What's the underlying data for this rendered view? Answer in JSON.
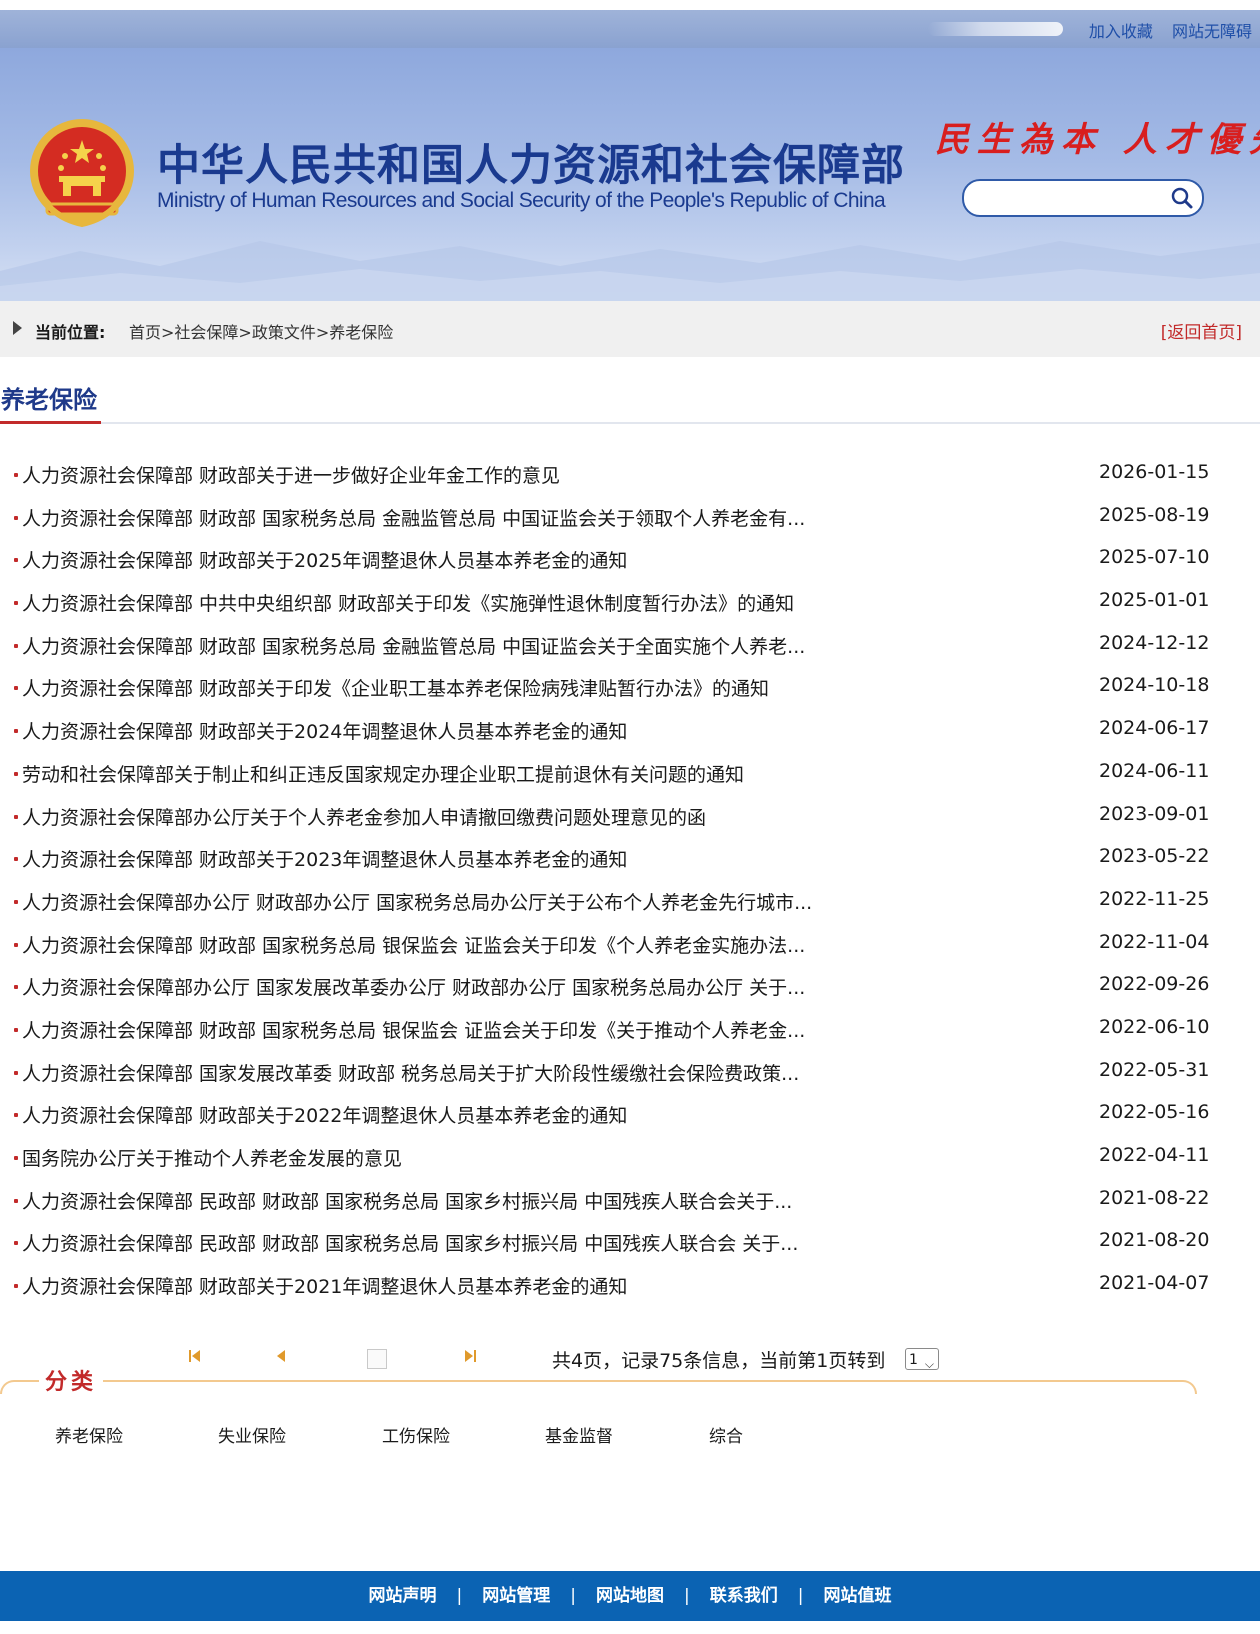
{
  "topbar": {
    "links": [
      "加入收藏",
      "网站无障碍"
    ]
  },
  "header": {
    "title_cn": "中华人民共和国人力资源和社会保障部",
    "title_en": "Ministry of Human Resources and Social Security of the People's Republic of China",
    "slogan": "民生為本 人才優先",
    "search": {
      "placeholder": ""
    }
  },
  "breadcrumb": {
    "label": "当前位置:",
    "path": "首页>社会保障>政策文件>养老保险",
    "back_home": "[返回首页]"
  },
  "section": {
    "title": "养老保险"
  },
  "items": [
    {
      "title": "人力资源社会保障部 财政部关于进一步做好企业年金工作的意见",
      "date": "2026-01-15"
    },
    {
      "title": "人力资源社会保障部 财政部 国家税务总局 金融监管总局 中国证监会关于领取个人养老金有...",
      "date": "2025-08-19"
    },
    {
      "title": "人力资源社会保障部 财政部关于2025年调整退休人员基本养老金的通知",
      "date": "2025-07-10"
    },
    {
      "title": "人力资源社会保障部 中共中央组织部 财政部关于印发《实施弹性退休制度暂行办法》的通知",
      "date": "2025-01-01"
    },
    {
      "title": "人力资源社会保障部 财政部 国家税务总局 金融监管总局 中国证监会关于全面实施个人养老...",
      "date": "2024-12-12"
    },
    {
      "title": "人力资源社会保障部 财政部关于印发《企业职工基本养老保险病残津贴暂行办法》的通知",
      "date": "2024-10-18"
    },
    {
      "title": "人力资源社会保障部 财政部关于2024年调整退休人员基本养老金的通知",
      "date": "2024-06-17"
    },
    {
      "title": "劳动和社会保障部关于制止和纠正违反国家规定办理企业职工提前退休有关问题的通知",
      "date": "2024-06-11"
    },
    {
      "title": "人力资源社会保障部办公厅关于个人养老金参加人申请撤回缴费问题处理意见的函",
      "date": "2023-09-01"
    },
    {
      "title": "人力资源社会保障部 财政部关于2023年调整退休人员基本养老金的通知",
      "date": "2023-05-22"
    },
    {
      "title": "人力资源社会保障部办公厅 财政部办公厅 国家税务总局办公厅关于公布个人养老金先行城市...",
      "date": "2022-11-25"
    },
    {
      "title": "人力资源社会保障部 财政部 国家税务总局 银保监会 证监会关于印发《个人养老金实施办法...",
      "date": "2022-11-04"
    },
    {
      "title": "人力资源社会保障部办公厅 国家发展改革委办公厅 财政部办公厅 国家税务总局办公厅 关于...",
      "date": "2022-09-26"
    },
    {
      "title": "人力资源社会保障部 财政部 国家税务总局 银保监会 证监会关于印发《关于推动个人养老金...",
      "date": "2022-06-10"
    },
    {
      "title": "人力资源社会保障部 国家发展改革委 财政部 税务总局关于扩大阶段性缓缴社会保险费政策...",
      "date": "2022-05-31"
    },
    {
      "title": "人力资源社会保障部 财政部关于2022年调整退休人员基本养老金的通知",
      "date": "2022-05-16"
    },
    {
      "title": "国务院办公厅关于推动个人养老金发展的意见",
      "date": "2022-04-11"
    },
    {
      "title": "人力资源社会保障部 民政部 财政部 国家税务总局 国家乡村振兴局 中国残疾人联合会关于...",
      "date": "2021-08-22"
    },
    {
      "title": "人力资源社会保障部 民政部 财政部 国家税务总局 国家乡村振兴局 中国残疾人联合会 关于...",
      "date": "2021-08-20"
    },
    {
      "title": "人力资源社会保障部 财政部关于2021年调整退休人员基本养老金的通知",
      "date": "2021-04-07"
    }
  ],
  "pager": {
    "info": "共4页，记录75条信息，当前第1页转到",
    "selected_page": "1"
  },
  "category": {
    "title": "分类",
    "items": [
      "养老保险",
      "失业保险",
      "工伤保险",
      "基金监督",
      "综合"
    ]
  },
  "footer": {
    "links": [
      "网站声明",
      "网站管理",
      "网站地图",
      "联系我们",
      "网站值班"
    ]
  },
  "colors": {
    "accent_blue": "#1f3a8a",
    "accent_red": "#c22a2a",
    "footer_blue": "#0b63b3"
  }
}
